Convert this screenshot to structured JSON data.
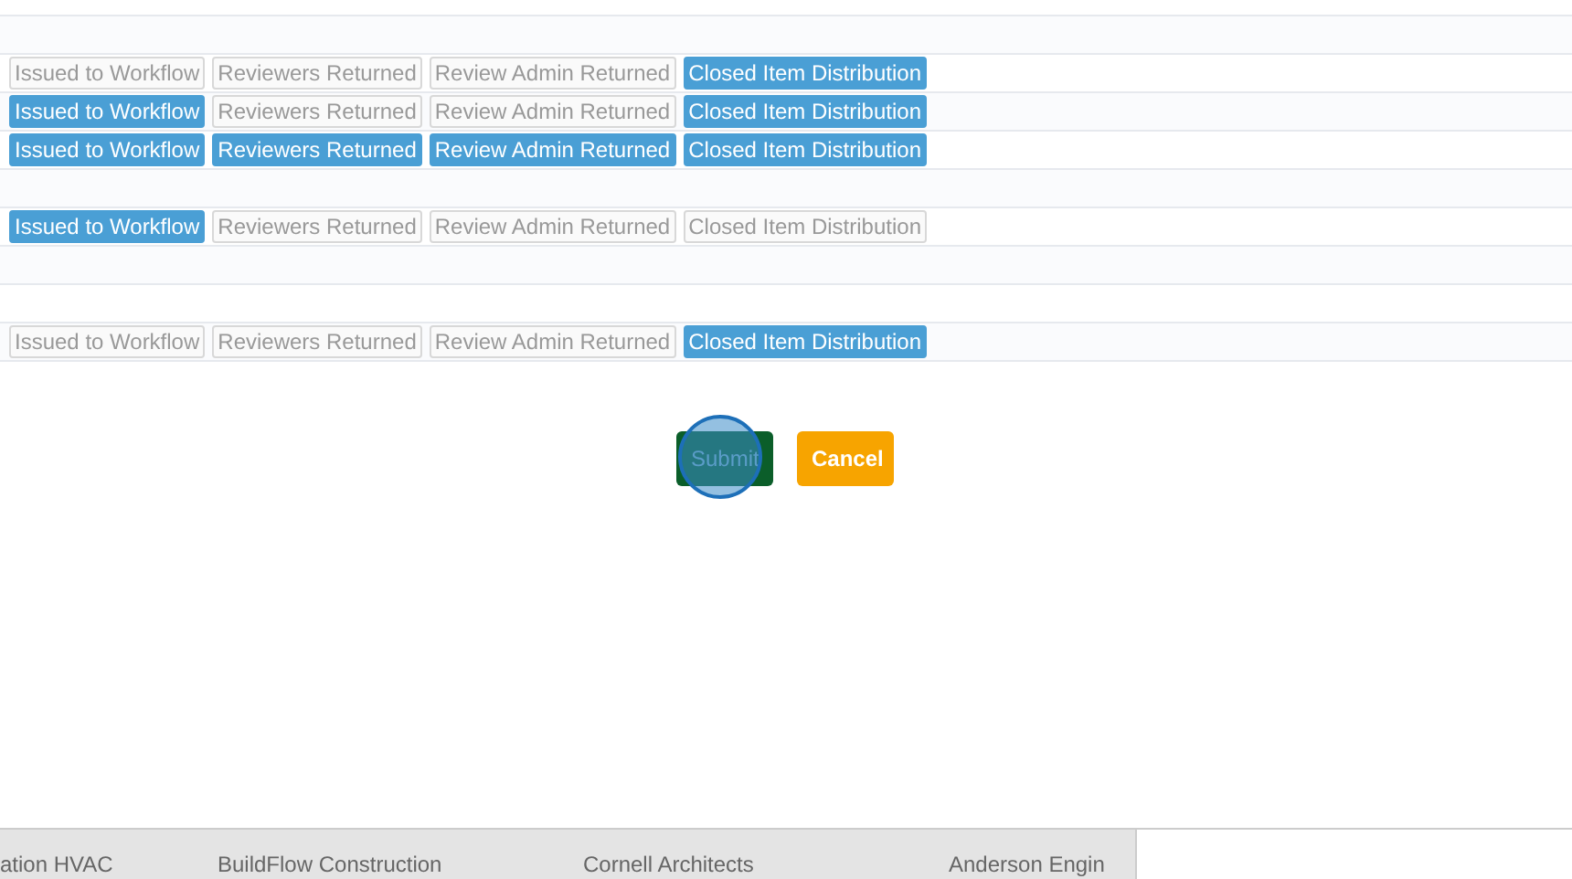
{
  "rows": [
    {
      "tags": []
    },
    {
      "tags": []
    },
    {
      "tags": [
        {
          "label": "Issued to Workflow",
          "on": false
        },
        {
          "label": "Reviewers Returned",
          "on": false
        },
        {
          "label": "Review Admin Returned",
          "on": false
        },
        {
          "label": "Closed Item Distribution",
          "on": true
        }
      ]
    },
    {
      "tags": [
        {
          "label": "Issued to Workflow",
          "on": true
        },
        {
          "label": "Reviewers Returned",
          "on": false
        },
        {
          "label": "Review Admin Returned",
          "on": false
        },
        {
          "label": "Closed Item Distribution",
          "on": true
        }
      ]
    },
    {
      "tags": [
        {
          "label": "Issued to Workflow",
          "on": true
        },
        {
          "label": "Reviewers Returned",
          "on": true
        },
        {
          "label": "Review Admin Returned",
          "on": true
        },
        {
          "label": "Closed Item Distribution",
          "on": true
        }
      ]
    },
    {
      "tags": []
    },
    {
      "tags": [
        {
          "label": "Issued to Workflow",
          "on": true
        },
        {
          "label": "Reviewers Returned",
          "on": false
        },
        {
          "label": "Review Admin Returned",
          "on": false
        },
        {
          "label": "Closed Item Distribution",
          "on": false
        }
      ]
    },
    {
      "tags": []
    },
    {
      "tags": []
    },
    {
      "tags": [
        {
          "label": "Issued to Workflow",
          "on": false
        },
        {
          "label": "Reviewers Returned",
          "on": false
        },
        {
          "label": "Review Admin Returned",
          "on": false
        },
        {
          "label": "Closed Item Distribution",
          "on": true
        }
      ]
    }
  ],
  "buttons": {
    "submit": "Submit",
    "cancel": "Cancel"
  },
  "footer": {
    "cells": [
      "ation HVAC",
      "BuildFlow Construction",
      "Cornell Architects",
      "Anderson Engin"
    ]
  }
}
